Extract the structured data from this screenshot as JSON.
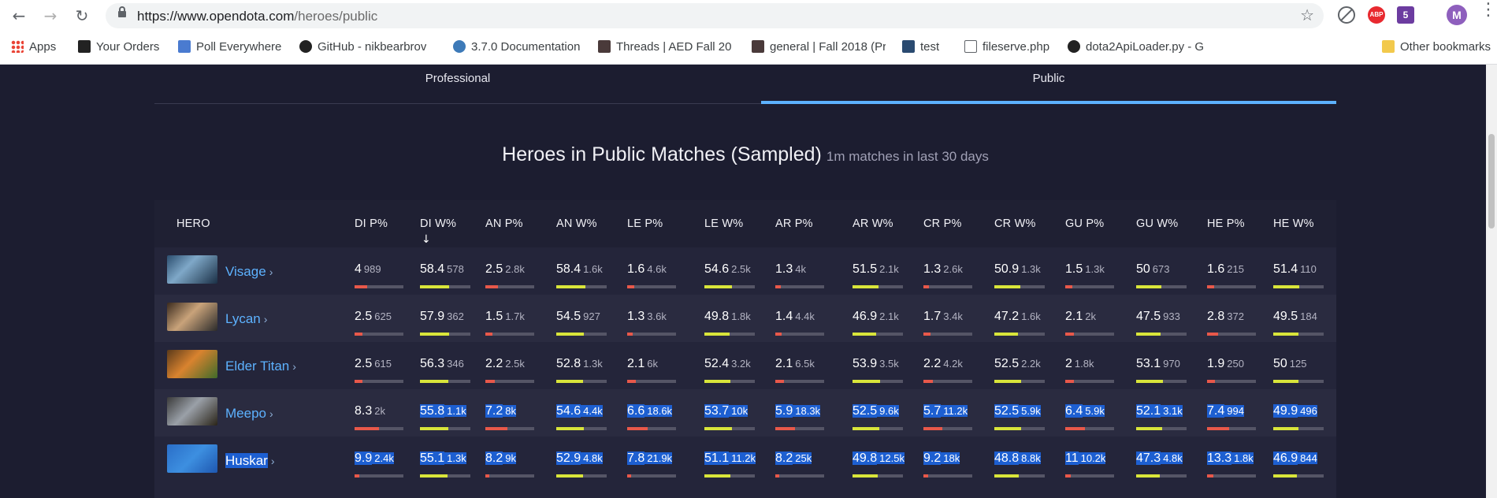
{
  "browser": {
    "url_host": "https://www.opendota.com",
    "url_path": "/heroes/public",
    "profile_initial": "M",
    "abp_label": "ABP",
    "html5_label": "5",
    "bookmarks": [
      {
        "label": "Apps",
        "icon": "apps-grid-icon"
      },
      {
        "label": "Your Orders",
        "icon": "amazon-icon"
      },
      {
        "label": "Poll Everywhere",
        "icon": "poll-everywhere-icon"
      },
      {
        "label": "GitHub - nikbearbrov",
        "icon": "github-icon"
      },
      {
        "label": "3.7.0 Documentation",
        "icon": "python-icon"
      },
      {
        "label": "Threads | AED Fall 20",
        "icon": "hashtag-icon"
      },
      {
        "label": "general | Fall 2018 (Pr",
        "icon": "hashtag-icon"
      },
      {
        "label": "test",
        "icon": "bird-icon"
      },
      {
        "label": "fileserve.php",
        "icon": "file-icon"
      },
      {
        "label": "dota2ApiLoader.py - G",
        "icon": "github-icon"
      },
      {
        "label": "Other bookmarks",
        "icon": "folder-icon"
      }
    ]
  },
  "tabs": [
    "Professional",
    "Public"
  ],
  "active_tab": "Public",
  "heading": {
    "title": "Heroes in Public Matches (Sampled)",
    "subtitle": "1m matches in last 30 days"
  },
  "columns": [
    "HERO",
    "DI P%",
    "DI W%",
    "AN P%",
    "AN W%",
    "LE P%",
    "LE W%",
    "AR P%",
    "AR W%",
    "CR P%",
    "CR W%",
    "GU P%",
    "GU W%",
    "HE P%",
    "HE W%"
  ],
  "sorted_column": "DI W%",
  "colors": {
    "accent": "#5db2ff",
    "bar_yellow": "#d9e53a",
    "bar_red": "#e8584a",
    "selection": "#1d5fd1"
  },
  "rows": [
    {
      "hero": "Visage",
      "selected": false,
      "cells": [
        [
          "4",
          "989"
        ],
        [
          "58.4",
          "578"
        ],
        [
          "2.5",
          "2.8k"
        ],
        [
          "58.4",
          "1.6k"
        ],
        [
          "1.6",
          "4.6k"
        ],
        [
          "54.6",
          "2.5k"
        ],
        [
          "1.3",
          "4k"
        ],
        [
          "51.5",
          "2.1k"
        ],
        [
          "1.3",
          "2.6k"
        ],
        [
          "50.9",
          "1.3k"
        ],
        [
          "1.5",
          "1.3k"
        ],
        [
          "50",
          "673"
        ],
        [
          "1.6",
          "215"
        ],
        [
          "51.4",
          "110"
        ]
      ],
      "fills": [
        0.25,
        0.58,
        0.25,
        0.58,
        0.14,
        0.55,
        0.12,
        0.52,
        0.12,
        0.51,
        0.14,
        0.5,
        0.14,
        0.51
      ]
    },
    {
      "hero": "Lycan",
      "selected": false,
      "cells": [
        [
          "2.5",
          "625"
        ],
        [
          "57.9",
          "362"
        ],
        [
          "1.5",
          "1.7k"
        ],
        [
          "54.5",
          "927"
        ],
        [
          "1.3",
          "3.6k"
        ],
        [
          "49.8",
          "1.8k"
        ],
        [
          "1.4",
          "4.4k"
        ],
        [
          "46.9",
          "2.1k"
        ],
        [
          "1.7",
          "3.4k"
        ],
        [
          "47.2",
          "1.6k"
        ],
        [
          "2.1",
          "2k"
        ],
        [
          "47.5",
          "933"
        ],
        [
          "2.8",
          "372"
        ],
        [
          "49.5",
          "184"
        ]
      ],
      "fills": [
        0.16,
        0.58,
        0.14,
        0.55,
        0.12,
        0.5,
        0.13,
        0.47,
        0.15,
        0.47,
        0.18,
        0.48,
        0.22,
        0.5
      ]
    },
    {
      "hero": "Elder Titan",
      "selected": false,
      "cells": [
        [
          "2.5",
          "615"
        ],
        [
          "56.3",
          "346"
        ],
        [
          "2.2",
          "2.5k"
        ],
        [
          "52.8",
          "1.3k"
        ],
        [
          "2.1",
          "6k"
        ],
        [
          "52.4",
          "3.2k"
        ],
        [
          "2.1",
          "6.5k"
        ],
        [
          "53.9",
          "3.5k"
        ],
        [
          "2.2",
          "4.2k"
        ],
        [
          "52.5",
          "2.2k"
        ],
        [
          "2",
          "1.8k"
        ],
        [
          "53.1",
          "970"
        ],
        [
          "1.9",
          "250"
        ],
        [
          "50",
          "125"
        ]
      ],
      "fills": [
        0.16,
        0.56,
        0.19,
        0.53,
        0.18,
        0.52,
        0.18,
        0.54,
        0.19,
        0.53,
        0.17,
        0.53,
        0.16,
        0.5
      ]
    },
    {
      "hero": "Meepo",
      "selected": false,
      "cells": [
        [
          "8.3",
          "2k"
        ],
        [
          "55.8",
          "1.1k"
        ],
        [
          "7.2",
          "8k"
        ],
        [
          "54.6",
          "4.4k"
        ],
        [
          "6.6",
          "18.6k"
        ],
        [
          "53.7",
          "10k"
        ],
        [
          "5.9",
          "18.3k"
        ],
        [
          "52.5",
          "9.6k"
        ],
        [
          "5.7",
          "11.2k"
        ],
        [
          "52.5",
          "5.9k"
        ],
        [
          "6.4",
          "5.9k"
        ],
        [
          "52.1",
          "3.1k"
        ],
        [
          "7.4",
          "994"
        ],
        [
          "49.9",
          "496"
        ]
      ],
      "fills": [
        0.5,
        0.56,
        0.45,
        0.55,
        0.42,
        0.54,
        0.4,
        0.53,
        0.39,
        0.53,
        0.41,
        0.52,
        0.45,
        0.5
      ],
      "selected_from": 1
    },
    {
      "hero": "Huskar",
      "selected": true,
      "cells": [
        [
          "9.9",
          "2.4k"
        ],
        [
          "55.1",
          "1.3k"
        ],
        [
          "8.2",
          "9k"
        ],
        [
          "52.9",
          "4.8k"
        ],
        [
          "7.8",
          "21.9k"
        ],
        [
          "51.1",
          "11.2k"
        ],
        [
          "8.2",
          "25k"
        ],
        [
          "49.8",
          "12.5k"
        ],
        [
          "9.2",
          "18k"
        ],
        [
          "48.8",
          "8.8k"
        ],
        [
          "11",
          "10.2k"
        ],
        [
          "47.3",
          "4.8k"
        ],
        [
          "13.3",
          "1.8k"
        ],
        [
          "46.9",
          "844"
        ]
      ],
      "fills": [
        0.1,
        0.55,
        0.08,
        0.53,
        0.08,
        0.51,
        0.08,
        0.5,
        0.09,
        0.49,
        0.11,
        0.47,
        0.13,
        0.47
      ],
      "selected_from": 0
    }
  ]
}
